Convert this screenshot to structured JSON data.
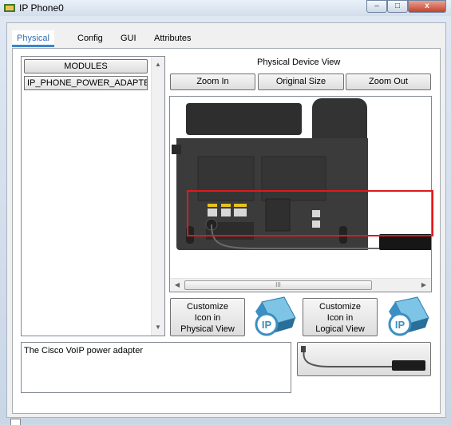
{
  "window": {
    "title": "IP Phone0",
    "close_label": "x",
    "min_label": "–",
    "max_label": "□"
  },
  "tabs": [
    {
      "label": "Physical",
      "active": true
    },
    {
      "label": "Config"
    },
    {
      "label": "GUI"
    },
    {
      "label": "Attributes"
    }
  ],
  "modules": {
    "header": "MODULES",
    "items": [
      "IP_PHONE_POWER_ADAPTER"
    ]
  },
  "physical_view": {
    "title": "Physical Device View",
    "zoom_in": "Zoom In",
    "original_size": "Original Size",
    "zoom_out": "Zoom Out",
    "scroll_thumb_grip": "III"
  },
  "customize": {
    "physical": [
      "Customize",
      "Icon in",
      "Physical View"
    ],
    "logical": [
      "Customize",
      "Icon in",
      "Logical View"
    ],
    "icon_text": "IP"
  },
  "description": "The Cisco VoIP power adapter",
  "colors": {
    "highlight": "#e0191d",
    "active_tab": "#2f6eb5",
    "ip_icon": "#4ba0cf"
  }
}
